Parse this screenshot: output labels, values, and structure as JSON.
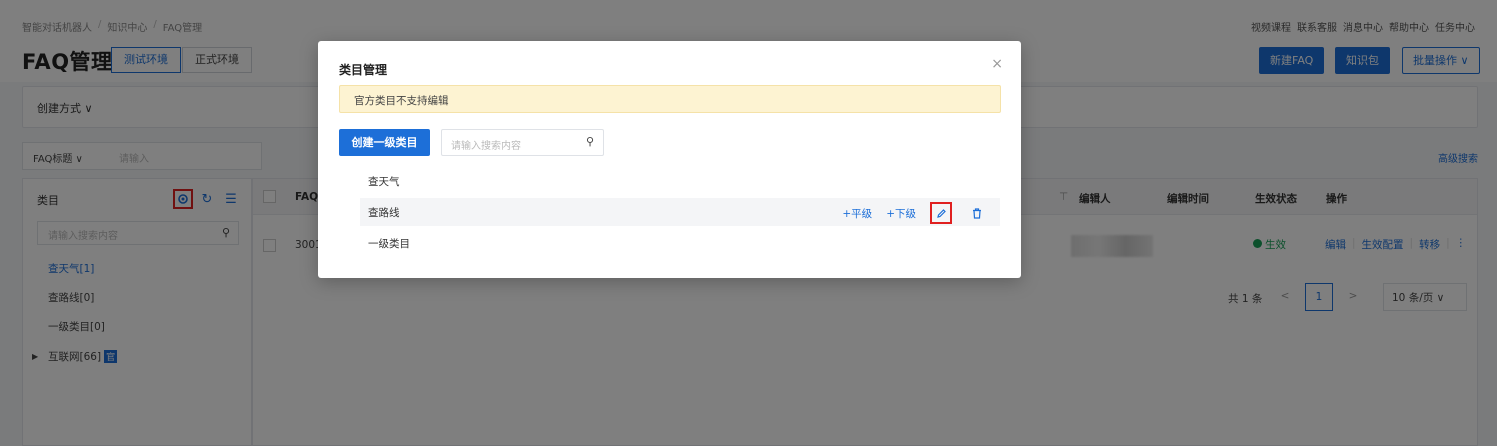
{
  "breadcrumb": [
    "智能对话机器人",
    "知识中心",
    "FAQ管理"
  ],
  "top_links": [
    "视频课程",
    "联系客服",
    "消息中心",
    "帮助中心",
    "任务中心"
  ],
  "page": {
    "title": "FAQ管理",
    "env_tabs": [
      "测试环境",
      "正式环境"
    ],
    "new_faq": "新建FAQ",
    "knowledge_pack": "知识包",
    "batch_ops": "批量操作 ∨"
  },
  "filter": {
    "create_method": "创建方式 ∨"
  },
  "search": {
    "field": "FAQ标题 ∨",
    "placeholder": "请输入",
    "advanced": "高级搜索"
  },
  "category_panel": {
    "title": "类目",
    "placeholder": "请输入搜索内容",
    "items": [
      {
        "label": "查天气[1]",
        "active": true
      },
      {
        "label": "查路线[0]",
        "active": false
      },
      {
        "label": "一级类目[0]",
        "active": false
      },
      {
        "label": "互联网[66]",
        "active": false,
        "badge": "官"
      }
    ]
  },
  "table": {
    "headers": {
      "faq": "FAQ",
      "editor": "编辑人",
      "edit_time": "编辑时间",
      "status": "生效状态",
      "ops": "操作"
    },
    "rows": [
      {
        "id": "3001",
        "status": "生效",
        "ops": [
          "编辑",
          "生效配置",
          "转移",
          "⋮"
        ]
      }
    ],
    "pagination": {
      "total": "共 1 条",
      "prev": "<",
      "page": "1",
      "next": ">",
      "page_size": "10 条/页 ∨"
    }
  },
  "modal": {
    "title": "类目管理",
    "close": "×",
    "notice": "官方类目不支持编辑",
    "create_button": "创建一级类目",
    "search_placeholder": "请输入搜索内容",
    "categories": [
      {
        "name": "查天气"
      },
      {
        "name": "查路线",
        "actions": {
          "add_sibling": "+平级",
          "add_child": "+下级"
        }
      },
      {
        "name": "一级类目"
      }
    ]
  },
  "colors": {
    "primary": "#1d6fd8",
    "highlight_box": "#e02020",
    "notice_bg": "#fdf3d2",
    "success": "#18a058"
  }
}
